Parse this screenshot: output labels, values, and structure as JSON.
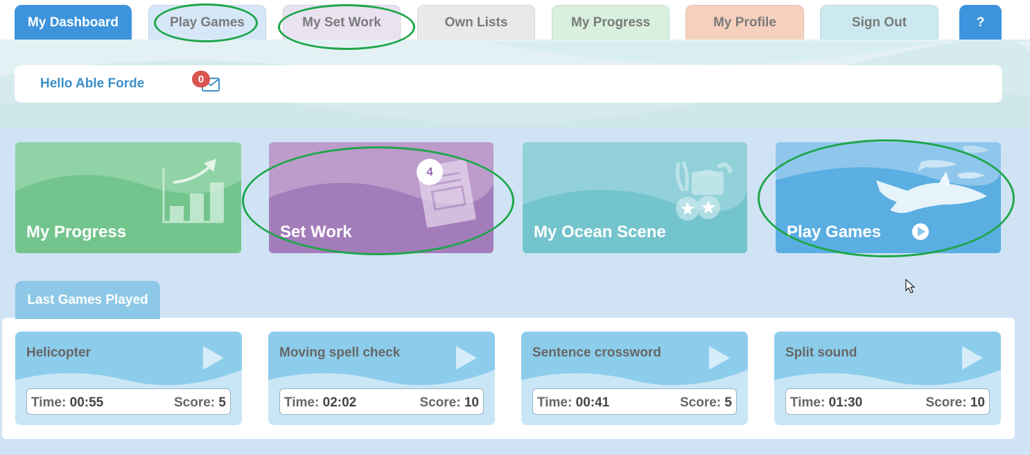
{
  "tabs": [
    {
      "label": "My Dashboard",
      "color": "#3d94dc",
      "active": true
    },
    {
      "label": "Play Games",
      "color": "#d6e8f8"
    },
    {
      "label": "My Set Work",
      "color": "#e9e2f1"
    },
    {
      "label": "Own Lists",
      "color": "#e9e9e9"
    },
    {
      "label": "My Progress",
      "color": "#d9f0df"
    },
    {
      "label": "My Profile",
      "color": "#f6d1bd"
    },
    {
      "label": "Sign Out",
      "color": "#cbe9ef"
    },
    {
      "label": "?",
      "color": "#3d94dc"
    }
  ],
  "greeting": {
    "text": "Hello Able Forde",
    "mail_count": "0",
    "mail_icon": "envelope-icon"
  },
  "cards": [
    {
      "title": "My Progress",
      "color": "#78c894",
      "icon": "chart-arrow-icon"
    },
    {
      "title": "Set Work",
      "color": "#a57dbb",
      "badge": "4",
      "icon": "worksheet-icon"
    },
    {
      "title": "My Ocean Scene",
      "color": "#7ac7d3",
      "icon": "treasure-chest-icon"
    },
    {
      "title": "Play Games",
      "color": "#5aaee2",
      "icon": "shark-icon"
    }
  ],
  "last_games": {
    "tab_label": "Last Games Played",
    "time_label": "Time:",
    "score_label": "Score:",
    "games": [
      {
        "name": "Helicopter",
        "time": "00:55",
        "score": "5"
      },
      {
        "name": "Moving spell check",
        "time": "02:02",
        "score": "10"
      },
      {
        "name": "Sentence crossword",
        "time": "00:41",
        "score": "5"
      },
      {
        "name": "Split sound",
        "time": "01:30",
        "score": "10"
      }
    ]
  },
  "colors": {
    "accent": "#3d94dc",
    "annotation": "#1fa64a",
    "page_bg": "#cfe3f5"
  }
}
